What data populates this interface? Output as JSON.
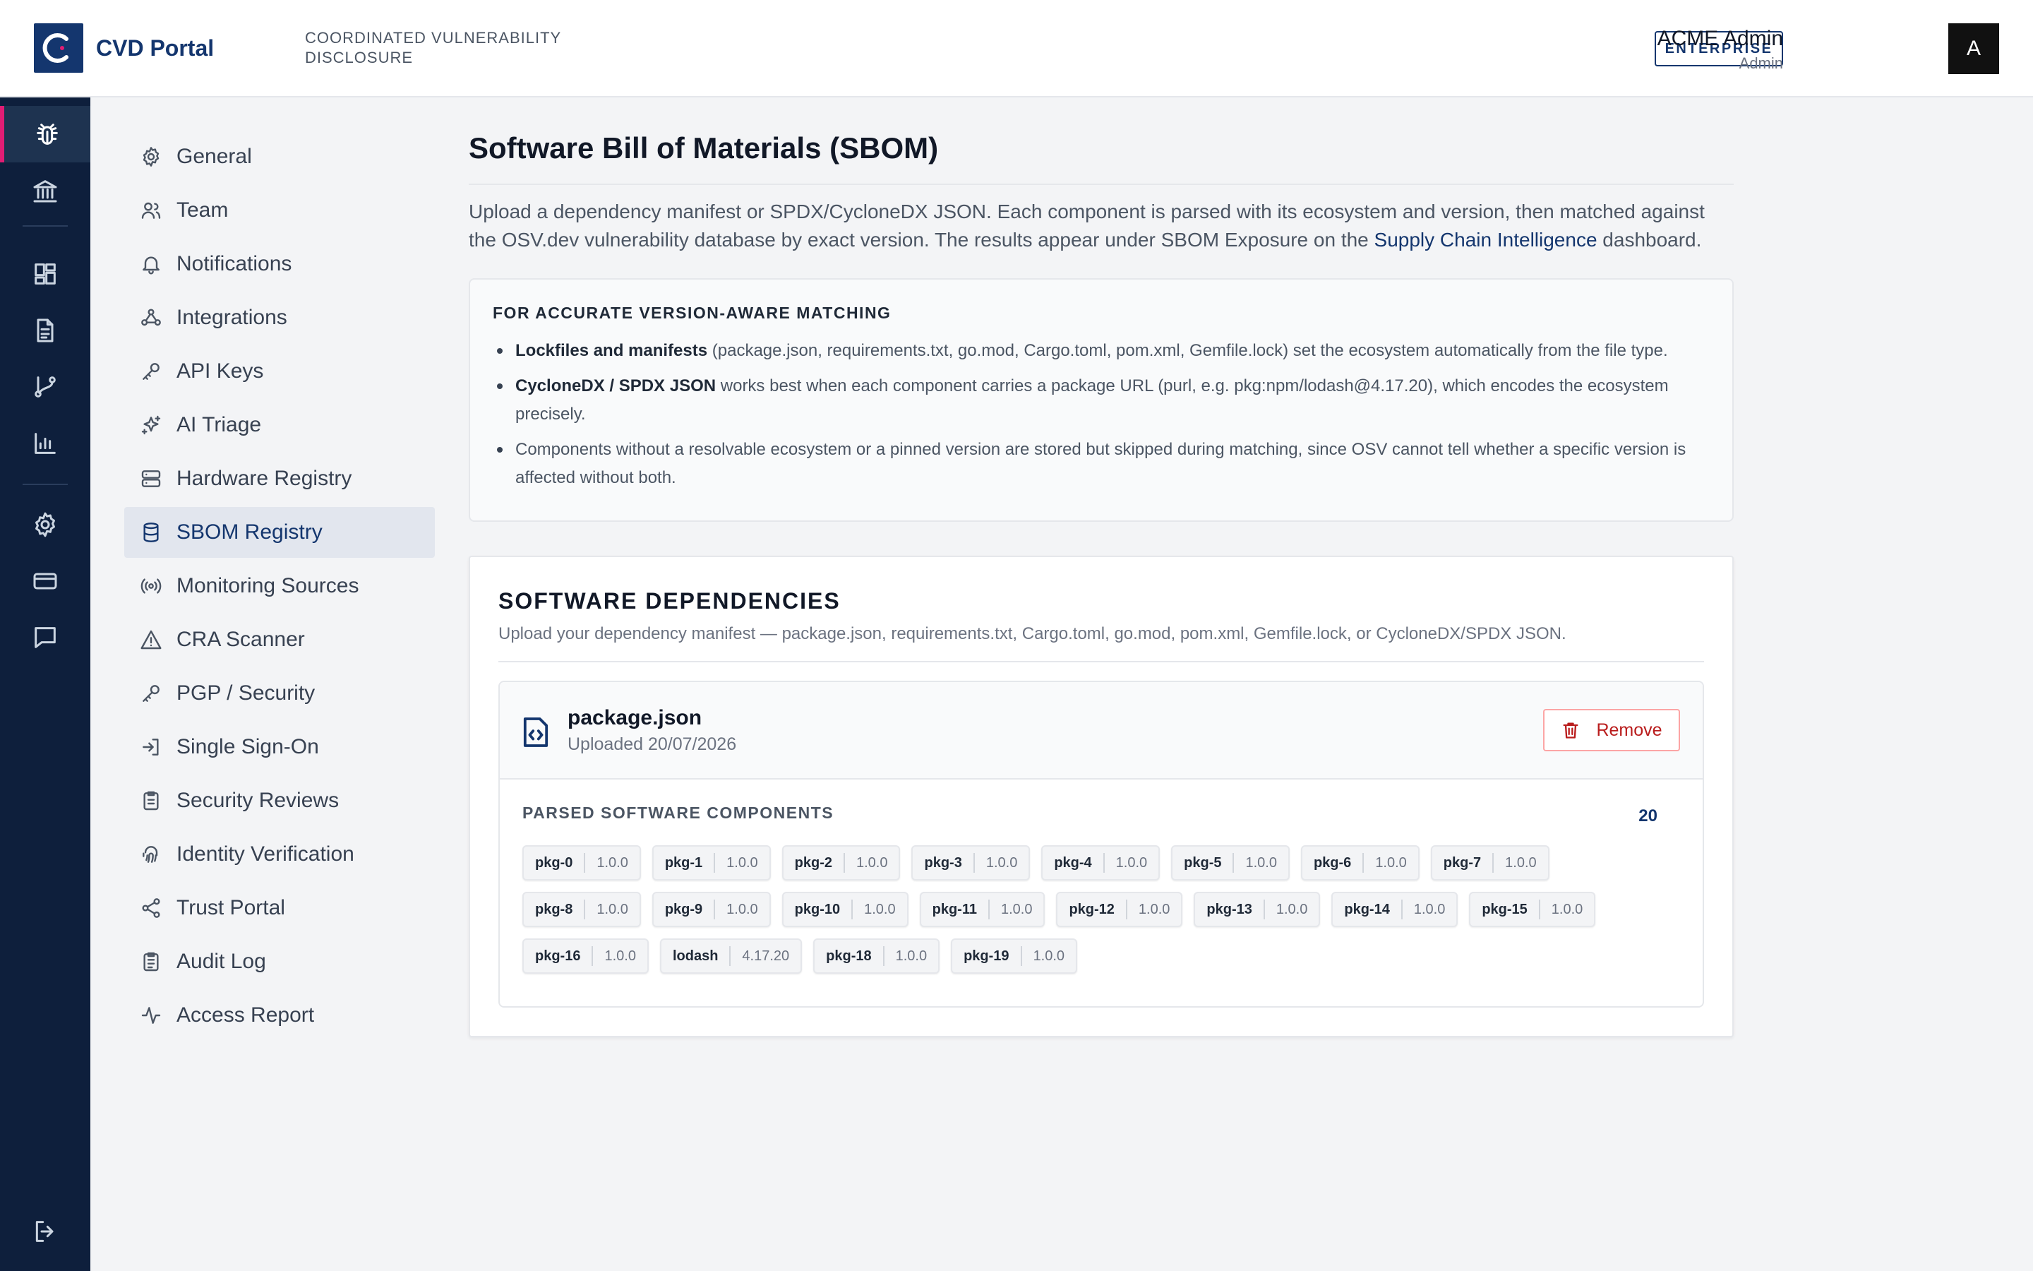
{
  "header": {
    "app_name": "CVD Portal",
    "app_subtitle": "COORDINATED VULNERABILITY DISCLOSURE",
    "plan_badge": "ENTERPRISE",
    "user_name": "ACME Admin",
    "user_role": "Admin",
    "avatar_initial": "A"
  },
  "rail": {
    "items": [
      {
        "icon": "bug-icon",
        "active": true
      },
      {
        "icon": "bank-icon"
      },
      {
        "icon": "grid-icon"
      },
      {
        "icon": "document-icon"
      },
      {
        "icon": "git-branch-icon"
      },
      {
        "icon": "bar-chart-icon"
      },
      {
        "icon": "gear-icon"
      },
      {
        "icon": "credit-card-icon"
      },
      {
        "icon": "chat-icon"
      },
      {
        "icon": "logout-icon"
      }
    ]
  },
  "settings_nav": {
    "active": "SBOM Registry",
    "items": [
      {
        "label": "General",
        "icon": "gear-icon"
      },
      {
        "label": "Team",
        "icon": "users-icon"
      },
      {
        "label": "Notifications",
        "icon": "bell-icon"
      },
      {
        "label": "Integrations",
        "icon": "webhook-icon"
      },
      {
        "label": "API Keys",
        "icon": "key-icon"
      },
      {
        "label": "AI Triage",
        "icon": "sparkles-icon"
      },
      {
        "label": "Hardware Registry",
        "icon": "server-icon"
      },
      {
        "label": "SBOM Registry",
        "icon": "database-icon"
      },
      {
        "label": "Monitoring Sources",
        "icon": "radio-icon"
      },
      {
        "label": "CRA Scanner",
        "icon": "warning-icon"
      },
      {
        "label": "PGP / Security",
        "icon": "key-icon"
      },
      {
        "label": "Single Sign-On",
        "icon": "login-icon"
      },
      {
        "label": "Security Reviews",
        "icon": "clipboard-icon"
      },
      {
        "label": "Identity Verification",
        "icon": "fingerprint-icon"
      },
      {
        "label": "Trust Portal",
        "icon": "share-icon"
      },
      {
        "label": "Audit Log",
        "icon": "clipboard-list-icon"
      },
      {
        "label": "Access Report",
        "icon": "activity-icon"
      }
    ]
  },
  "main": {
    "title": "Software Bill of Materials (SBOM)",
    "intro_text": "Upload a dependency manifest or SPDX/CycloneDX JSON. Each component is parsed with its ecosystem and version, then matched against the OSV.dev vulnerability database by exact version. The results appear under SBOM Exposure on the ",
    "intro_link": "Supply Chain Intelligence",
    "intro_tail": " dashboard.",
    "info": {
      "heading": "FOR ACCURATE VERSION-AWARE MATCHING",
      "bullets": [
        {
          "bold": "Lockfiles and manifests",
          "text": " (package.json, requirements.txt, go.mod, Cargo.toml, pom.xml, Gemfile.lock) set the ecosystem automatically from the file type."
        },
        {
          "bold": "CycloneDX / SPDX JSON",
          "text": " works best when each component carries a package URL (purl, e.g. pkg:npm/lodash@4.17.20), which encodes the ecosystem precisely."
        },
        {
          "bold": "",
          "text": "Components without a resolvable ecosystem or a pinned version are stored but skipped during matching, since OSV cannot tell whether a specific version is affected without both."
        }
      ]
    },
    "dependencies": {
      "title": "SOFTWARE DEPENDENCIES",
      "subtitle": "Upload your dependency manifest — package.json, requirements.txt, Cargo.toml, go.mod, pom.xml, Gemfile.lock, or CycloneDX/SPDX JSON.",
      "file": {
        "name": "package.json",
        "uploaded": "Uploaded 20/07/2026",
        "remove_label": "Remove"
      },
      "components_heading": "PARSED SOFTWARE COMPONENTS",
      "components_count": "20",
      "components": [
        {
          "name": "pkg-0",
          "version": "1.0.0"
        },
        {
          "name": "pkg-1",
          "version": "1.0.0"
        },
        {
          "name": "pkg-2",
          "version": "1.0.0"
        },
        {
          "name": "pkg-3",
          "version": "1.0.0"
        },
        {
          "name": "pkg-4",
          "version": "1.0.0"
        },
        {
          "name": "pkg-5",
          "version": "1.0.0"
        },
        {
          "name": "pkg-6",
          "version": "1.0.0"
        },
        {
          "name": "pkg-7",
          "version": "1.0.0"
        },
        {
          "name": "pkg-8",
          "version": "1.0.0"
        },
        {
          "name": "pkg-9",
          "version": "1.0.0"
        },
        {
          "name": "pkg-10",
          "version": "1.0.0"
        },
        {
          "name": "pkg-11",
          "version": "1.0.0"
        },
        {
          "name": "pkg-12",
          "version": "1.0.0"
        },
        {
          "name": "pkg-13",
          "version": "1.0.0"
        },
        {
          "name": "pkg-14",
          "version": "1.0.0"
        },
        {
          "name": "pkg-15",
          "version": "1.0.0"
        },
        {
          "name": "pkg-16",
          "version": "1.0.0"
        },
        {
          "name": "lodash",
          "version": "4.17.20"
        },
        {
          "name": "pkg-18",
          "version": "1.0.0"
        },
        {
          "name": "pkg-19",
          "version": "1.0.0"
        }
      ]
    }
  },
  "colors": {
    "brand": "#14366e",
    "rail_bg": "#0e1f3c",
    "active_accent": "#e11d74",
    "danger": "#b91c1c"
  }
}
